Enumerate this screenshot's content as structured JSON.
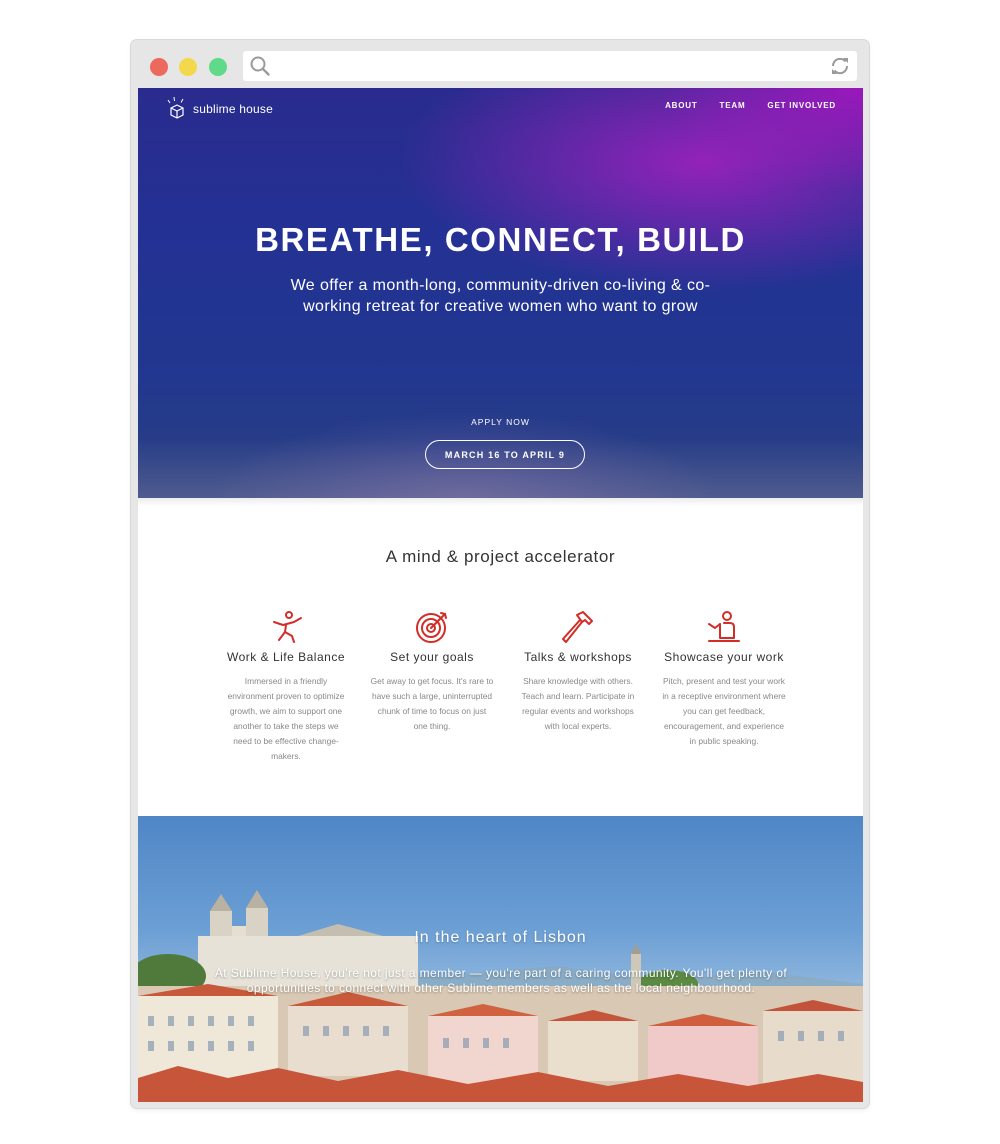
{
  "browser": {
    "traffic_lights": [
      "#ec6a5d",
      "#f4d84c",
      "#5fd98a"
    ]
  },
  "site": {
    "logo_text": "sublime house",
    "nav": [
      "ABOUT",
      "TEAM",
      "GET INVOLVED"
    ]
  },
  "hero": {
    "title": "BREATHE, CONNECT, BUILD",
    "subtitle": "We offer a month-long, community-driven co-living & co-working retreat for creative women who want to grow",
    "apply_label": "APPLY NOW",
    "date_button": "MARCH 16 TO APRIL 9"
  },
  "features": {
    "title": "A mind & project accelerator",
    "accent_color": "#d32d27",
    "items": [
      {
        "icon": "person-jumping-icon",
        "title": "Work & Life Balance",
        "desc": "Immersed in a friendly environment proven to optimize growth, we aim to support one another to take the steps we need to be effective change-makers."
      },
      {
        "icon": "target-icon",
        "title": "Set your goals",
        "desc": "Get away to get focus. It's rare to have such a large, uninterrupted chunk of time to focus on just one thing."
      },
      {
        "icon": "hammer-icon",
        "title": "Talks & workshops",
        "desc": "Share knowledge with others. Teach and learn. Participate in regular events and workshops with local experts."
      },
      {
        "icon": "presenter-icon",
        "title": "Showcase your work",
        "desc": "Pitch, present and test your work in a receptive environment where you can get feedback, encouragement, and experience in public speaking."
      }
    ]
  },
  "lisbon": {
    "title": "In the heart of Lisbon",
    "text": "At Sublime House, you're not just a member — you're part of a caring community. You'll get plenty of opportunities to connect with other Sublime members as well as the local neighbourhood."
  }
}
